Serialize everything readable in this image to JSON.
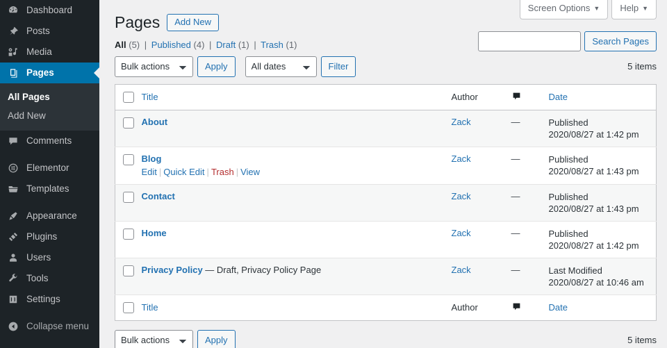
{
  "sidebar": {
    "items": [
      {
        "label": "Dashboard",
        "icon": "dashboard-icon",
        "active": false
      },
      {
        "label": "Posts",
        "icon": "pin-icon",
        "active": false
      },
      {
        "label": "Media",
        "icon": "media-icon",
        "active": false
      },
      {
        "label": "Pages",
        "icon": "pages-icon",
        "active": true
      },
      {
        "label": "Comments",
        "icon": "comment-icon",
        "active": false
      },
      {
        "label": "Elementor",
        "icon": "elementor-icon",
        "active": false
      },
      {
        "label": "Templates",
        "icon": "folder-icon",
        "active": false
      },
      {
        "label": "Appearance",
        "icon": "brush-icon",
        "active": false
      },
      {
        "label": "Plugins",
        "icon": "plug-icon",
        "active": false
      },
      {
        "label": "Users",
        "icon": "user-icon",
        "active": false
      },
      {
        "label": "Tools",
        "icon": "wrench-icon",
        "active": false
      },
      {
        "label": "Settings",
        "icon": "settings-icon",
        "active": false
      },
      {
        "label": "Collapse menu",
        "icon": "collapse-icon",
        "active": false
      }
    ],
    "submenu": [
      {
        "label": "All Pages",
        "current": true
      },
      {
        "label": "Add New",
        "current": false
      }
    ]
  },
  "screen_meta": {
    "screen_options": "Screen Options",
    "help": "Help",
    "caret": "▼"
  },
  "header": {
    "title": "Pages",
    "add_new": "Add New"
  },
  "search": {
    "value": "",
    "placeholder": "",
    "button": "Search Pages"
  },
  "filters": {
    "items": [
      {
        "label": "All",
        "count": "(5)",
        "current": true
      },
      {
        "label": "Published",
        "count": "(4)",
        "current": false
      },
      {
        "label": "Draft",
        "count": "(1)",
        "current": false
      },
      {
        "label": "Trash",
        "count": "(1)",
        "current": false
      }
    ],
    "separator": "|"
  },
  "tablenav_top": {
    "bulk_actions": "Bulk actions",
    "apply": "Apply",
    "all_dates": "All dates",
    "filter": "Filter",
    "items": "5 items"
  },
  "tablenav_bottom": {
    "bulk_actions": "Bulk actions",
    "apply": "Apply",
    "items": "5 items"
  },
  "table": {
    "columns": {
      "title": "Title",
      "author": "Author",
      "comments": "comment-bubble-icon",
      "date": "Date"
    },
    "rows": [
      {
        "title": "About",
        "state": "",
        "author": "Zack",
        "comments": "—",
        "date_status": "Published",
        "date_value": "2020/08/27 at 1:42 pm",
        "alt": true,
        "actions": []
      },
      {
        "title": "Blog",
        "state": "",
        "author": "Zack",
        "comments": "—",
        "date_status": "Published",
        "date_value": "2020/08/27 at 1:43 pm",
        "alt": false,
        "actions": [
          {
            "label": "Edit",
            "kind": "edit"
          },
          {
            "label": "Quick Edit",
            "kind": "quick-edit"
          },
          {
            "label": "Trash",
            "kind": "trash"
          },
          {
            "label": "View",
            "kind": "view"
          }
        ]
      },
      {
        "title": "Contact",
        "state": "",
        "author": "Zack",
        "comments": "—",
        "date_status": "Published",
        "date_value": "2020/08/27 at 1:43 pm",
        "alt": true,
        "actions": []
      },
      {
        "title": "Home",
        "state": "",
        "author": "Zack",
        "comments": "—",
        "date_status": "Published",
        "date_value": "2020/08/27 at 1:42 pm",
        "alt": false,
        "actions": []
      },
      {
        "title": "Privacy Policy",
        "state": " — Draft, Privacy Policy Page",
        "author": "Zack",
        "comments": "—",
        "date_status": "Last Modified",
        "date_value": "2020/08/27 at 10:46 am",
        "alt": true,
        "actions": []
      }
    ]
  },
  "colors": {
    "sidebar_bg": "#1d2327",
    "submenu_bg": "#2c3338",
    "active_blue": "#0073aa",
    "link_blue": "#2271b1",
    "trash_red": "#b32d2e",
    "page_bg": "#f0f0f1",
    "row_alt": "#f6f7f7"
  }
}
